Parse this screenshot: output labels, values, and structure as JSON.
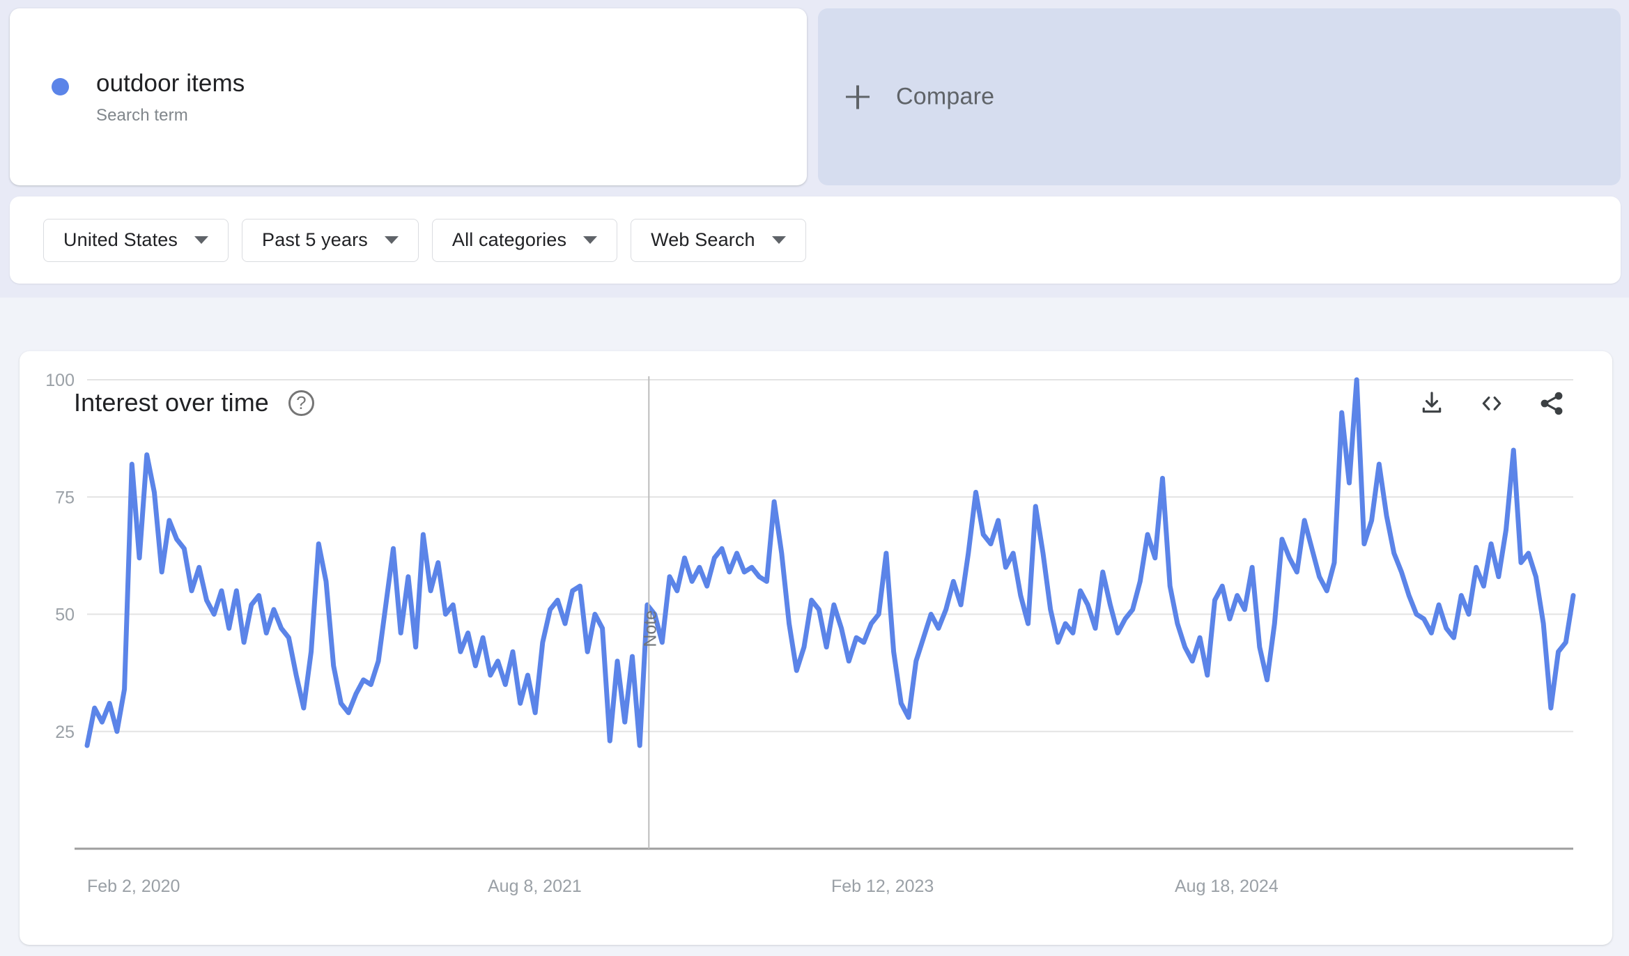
{
  "search_term": {
    "name": "outdoor items",
    "type_label": "Search term",
    "dot_color": "#5b84e8"
  },
  "compare": {
    "label": "Compare",
    "icon": "plus-icon"
  },
  "filters": [
    {
      "key": "location",
      "label": "United States",
      "icon": "chevron-down-icon"
    },
    {
      "key": "time_range",
      "label": "Past 5 years",
      "icon": "chevron-down-icon"
    },
    {
      "key": "category",
      "label": "All categories",
      "icon": "chevron-down-icon"
    },
    {
      "key": "search_type",
      "label": "Web Search",
      "icon": "chevron-down-icon"
    }
  ],
  "chart_card": {
    "title": "Interest over time",
    "help_icon": "help-circle-icon",
    "help_glyph": "?",
    "actions": [
      {
        "key": "download",
        "name": "download-icon"
      },
      {
        "key": "embed",
        "name": "embed-code-icon"
      },
      {
        "key": "share",
        "name": "share-icon"
      }
    ]
  },
  "chart_data": {
    "type": "line",
    "title": "Interest over time",
    "xlabel": "",
    "ylabel": "",
    "ylim": [
      0,
      100
    ],
    "grid": true,
    "legend_position": "none",
    "series_color": "#5b84e8",
    "series": [
      {
        "name": "outdoor items",
        "values": [
          22,
          30,
          27,
          31,
          25,
          34,
          82,
          62,
          84,
          76,
          59,
          70,
          66,
          64,
          55,
          60,
          53,
          50,
          55,
          47,
          55,
          44,
          52,
          54,
          46,
          51,
          47,
          45,
          37,
          30,
          42,
          65,
          57,
          39,
          31,
          29,
          33,
          36,
          35,
          40,
          52,
          64,
          46,
          58,
          43,
          67,
          55,
          61,
          50,
          52,
          42,
          46,
          39,
          45,
          37,
          40,
          35,
          42,
          31,
          37,
          29,
          44,
          51,
          53,
          48,
          55,
          56,
          42,
          50,
          47,
          23,
          40,
          27,
          41,
          22,
          52,
          50,
          44,
          58,
          55,
          62,
          57,
          60,
          56,
          62,
          64,
          59,
          63,
          59,
          60,
          58,
          57,
          74,
          63,
          48,
          38,
          43,
          53,
          51,
          43,
          52,
          47,
          40,
          45,
          44,
          48,
          50,
          63,
          42,
          31,
          28,
          40,
          45,
          50,
          47,
          51,
          57,
          52,
          63,
          76,
          67,
          65,
          70,
          60,
          63,
          54,
          48,
          73,
          63,
          51,
          44,
          48,
          46,
          55,
          52,
          47,
          59,
          52,
          46,
          49,
          51,
          57,
          67,
          62,
          79,
          56,
          48,
          43,
          40,
          45,
          37,
          53,
          56,
          49,
          54,
          51,
          60,
          43,
          36,
          48,
          66,
          62,
          59,
          70,
          64,
          58,
          55,
          61,
          93,
          78,
          100,
          65,
          70,
          82,
          71,
          63,
          59,
          54,
          50,
          49,
          46,
          52,
          47,
          45,
          54,
          50,
          60,
          56,
          65,
          58,
          68,
          85,
          61,
          63,
          58,
          48,
          30,
          42,
          44,
          54
        ]
      }
    ],
    "y_ticks": [
      100,
      75,
      50,
      25
    ],
    "x_ticks": [
      "Feb 2, 2020",
      "Aug 8, 2021",
      "Feb 12, 2023",
      "Aug 18, 2024"
    ],
    "annotations": [
      {
        "type": "vertical-line",
        "label": "Note",
        "x_fraction": 0.378
      }
    ]
  }
}
